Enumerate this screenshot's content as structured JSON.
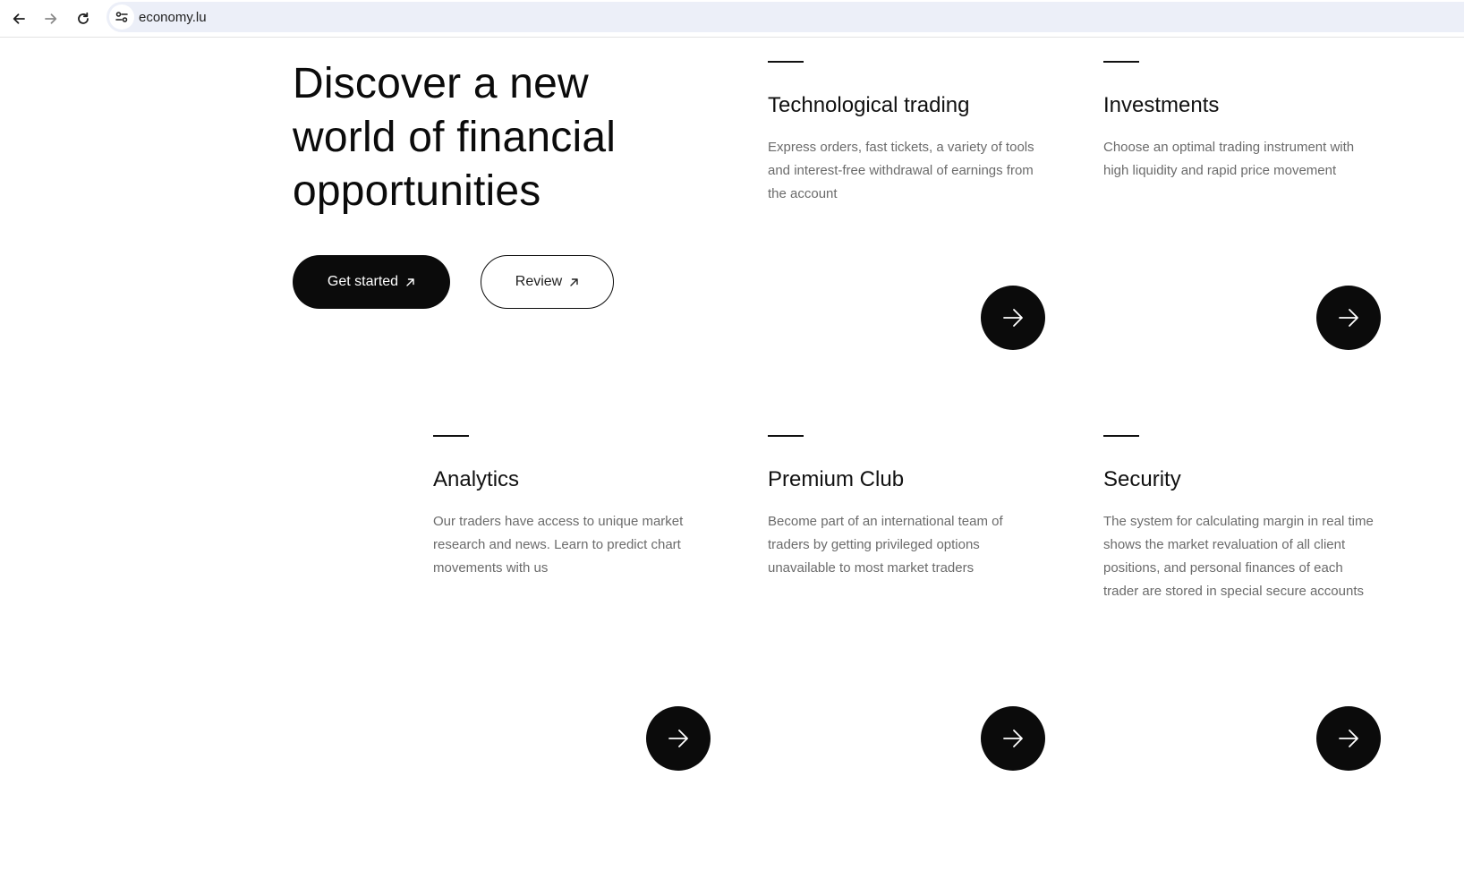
{
  "browser": {
    "url": "economy.lu",
    "back_icon": "arrow-left-icon",
    "forward_icon": "arrow-right-icon",
    "reload_icon": "reload-icon",
    "site_info_icon": "tune-icon"
  },
  "hero": {
    "title": "Discover a new world of financial opportunities",
    "primary_button": "Get started",
    "secondary_button": "Review",
    "button_icon": "arrow-up-right-icon"
  },
  "features": [
    {
      "title": "Technological trading",
      "description": "Express orders, fast tickets, a variety of tools and interest-free withdrawal of earnings from the account",
      "arrow_icon": "arrow-right-icon"
    },
    {
      "title": "Investments",
      "description": "Choose an optimal trading instrument with high liquidity and rapid price movement",
      "arrow_icon": "arrow-right-icon"
    },
    {
      "title": "Analytics",
      "description": "Our traders have access to unique market research and news. Learn to predict chart movements with us",
      "arrow_icon": "arrow-right-icon"
    },
    {
      "title": "Premium Club",
      "description": "Become part of an international team of traders by getting privileged options unavailable to most market traders",
      "arrow_icon": "arrow-right-icon"
    },
    {
      "title": "Security",
      "description": "The system for calculating margin in real time shows the market revaluation of all client positions, and personal finances of each trader are stored in special secure accounts",
      "arrow_icon": "arrow-right-icon"
    }
  ],
  "colors": {
    "primary": "#0b0b0b",
    "text": "#111111",
    "muted_text": "#6b6b6b",
    "omnibox_bg": "#eceff8"
  }
}
